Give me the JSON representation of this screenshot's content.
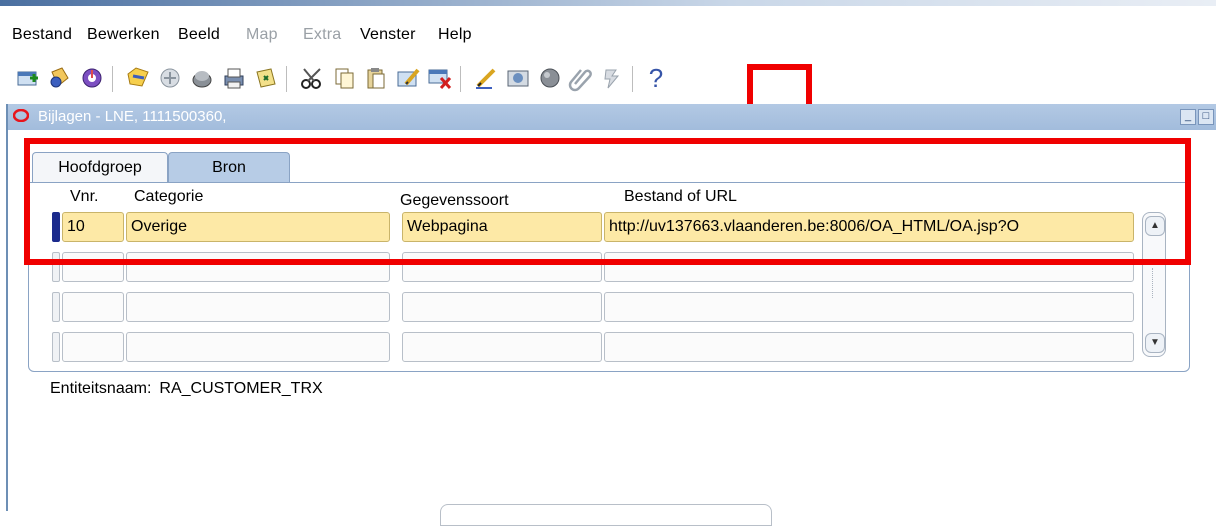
{
  "menubar": {
    "items": [
      {
        "label": "Bestand",
        "enabled": true
      },
      {
        "label": "Bewerken",
        "enabled": true
      },
      {
        "label": "Beeld",
        "enabled": true
      },
      {
        "label": "Map",
        "enabled": false
      },
      {
        "label": "Extra",
        "enabled": false
      },
      {
        "label": "Venster",
        "enabled": true
      },
      {
        "label": "Help",
        "enabled": true
      }
    ]
  },
  "toolbar": {
    "icons": [
      "new-record-icon",
      "search-icon",
      "navigate-icon",
      "save-icon",
      "print-icon",
      "close-form-icon",
      "print-setup-icon",
      "zoom-icon",
      "cut-icon",
      "copy-icon",
      "paste-icon",
      "edit-record-icon",
      "delete-record-icon",
      "edit-field-icon",
      "translations-icon",
      "folder-icon",
      "attachments-icon",
      "help-tree-icon",
      "help-icon"
    ],
    "help_glyph": "?"
  },
  "window": {
    "title": "Bijlagen - LNE, 1111500360,",
    "tabs": [
      {
        "label": "Hoofdgroep",
        "active": false
      },
      {
        "label": "Bron",
        "active": true
      }
    ],
    "columns": {
      "vnr": "Vnr.",
      "categorie": "Categorie",
      "gegevenssoort": "Gegevenssoort",
      "bestand": "Bestand of URL"
    },
    "rows": [
      {
        "vnr": "10",
        "categorie": "Overige",
        "gegevenssoort": "Webpagina",
        "bestand": "http://uv137663.vlaanderen.be:8006/OA_HTML/OA.jsp?O"
      },
      {
        "vnr": "",
        "categorie": "",
        "gegevenssoort": "",
        "bestand": ""
      },
      {
        "vnr": "",
        "categorie": "",
        "gegevenssoort": "",
        "bestand": ""
      },
      {
        "vnr": "",
        "categorie": "",
        "gegevenssoort": "",
        "bestand": ""
      }
    ],
    "entity_label": "Entiteitsnaam:",
    "entity_value": "RA_CUSTOMER_TRX"
  },
  "colors": {
    "highlight": "#f00000",
    "filled_cell": "#fde9a6",
    "titlebar": "#a2bcdc"
  }
}
